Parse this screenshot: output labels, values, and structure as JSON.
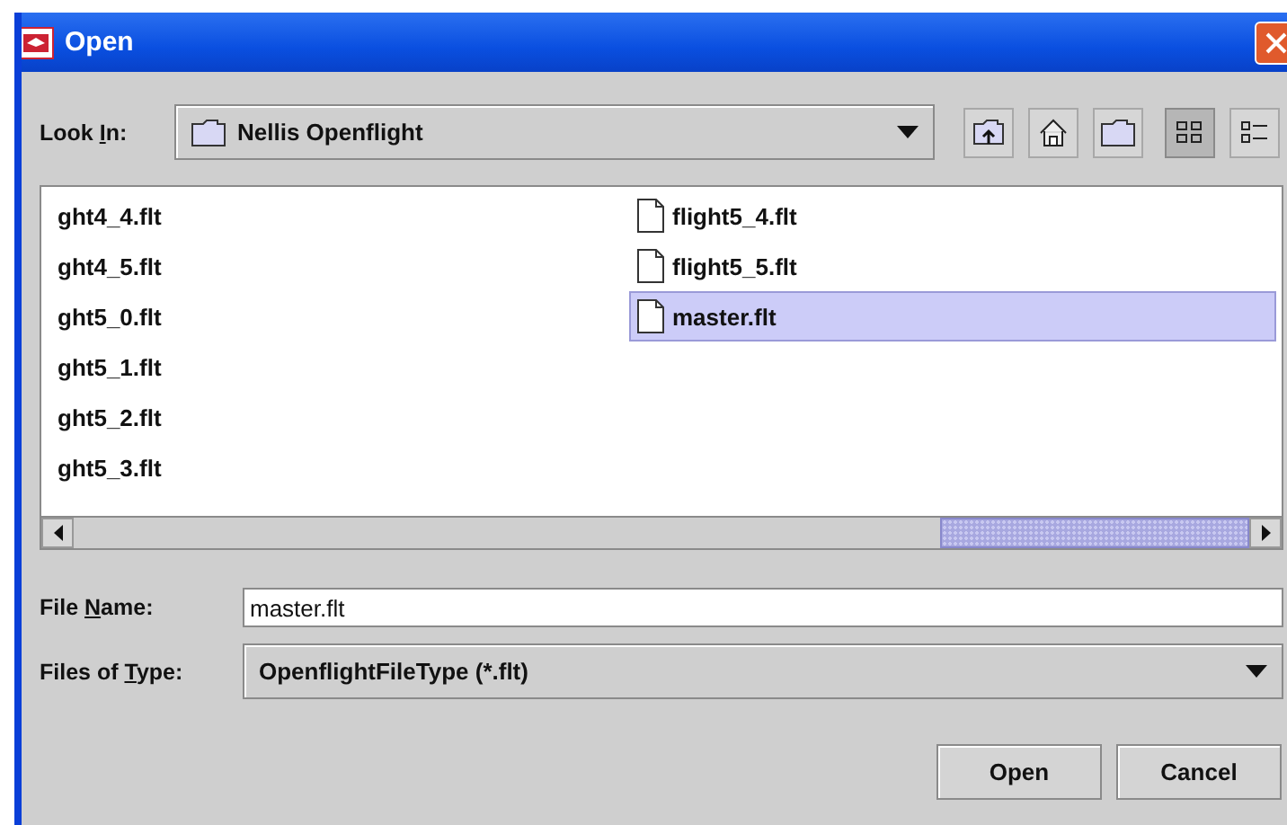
{
  "window": {
    "title": "Open"
  },
  "look_in": {
    "label_parts": [
      "Look ",
      "I",
      "n:"
    ],
    "value": "Nellis Openflight"
  },
  "view_buttons": [
    {
      "kind": "list",
      "selected": true
    },
    {
      "kind": "details",
      "selected": false
    }
  ],
  "file_columns": [
    [
      {
        "name": "ght4_4.flt",
        "selected": false
      },
      {
        "name": "ght4_5.flt",
        "selected": false
      },
      {
        "name": "ght5_0.flt",
        "selected": false
      },
      {
        "name": "ght5_1.flt",
        "selected": false
      },
      {
        "name": "ght5_2.flt",
        "selected": false
      },
      {
        "name": "ght5_3.flt",
        "selected": false
      }
    ],
    [
      {
        "name": "flight5_4.flt",
        "selected": false,
        "icon": true
      },
      {
        "name": "flight5_5.flt",
        "selected": false,
        "icon": true
      },
      {
        "name": "master.flt",
        "selected": true,
        "icon": true
      }
    ]
  ],
  "file_name": {
    "label_parts": [
      "File ",
      "N",
      "ame:"
    ],
    "value": "master.flt"
  },
  "file_type": {
    "label_parts": [
      "Files of ",
      "T",
      "ype:"
    ],
    "value": "OpenflightFileType (*.flt)"
  },
  "buttons": [
    "Open",
    "Cancel"
  ]
}
